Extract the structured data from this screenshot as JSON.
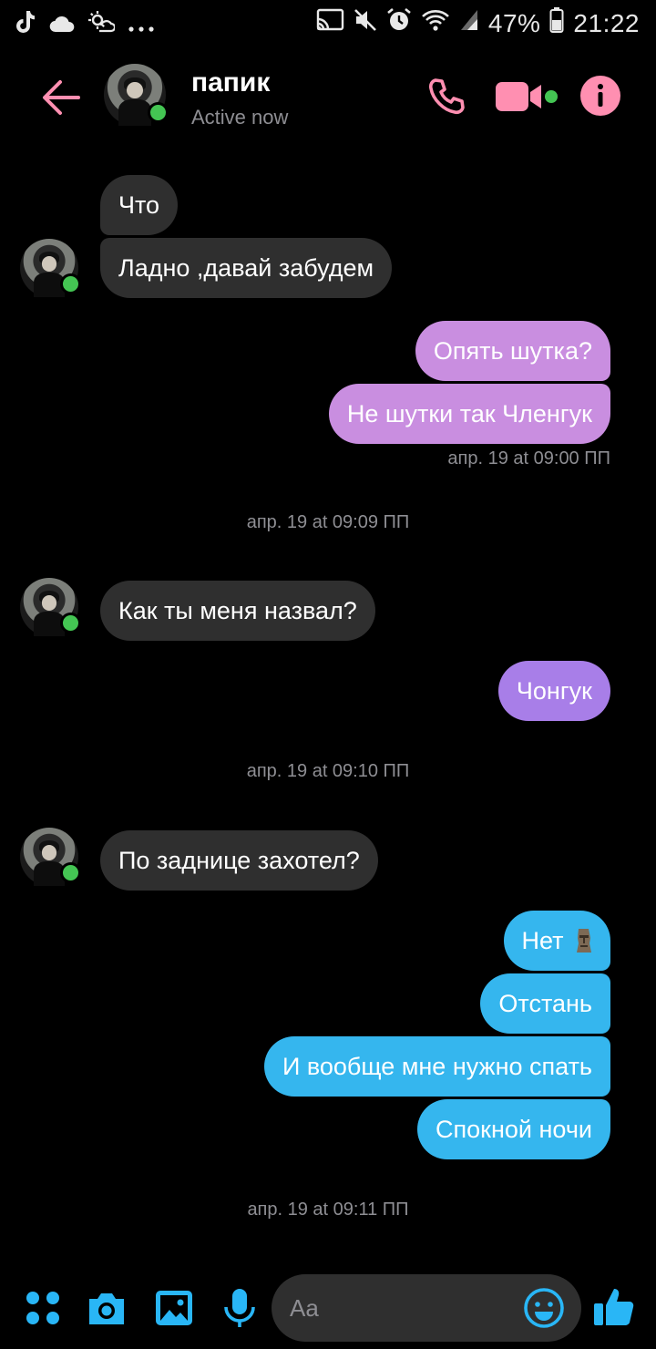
{
  "status_bar": {
    "battery": "47%",
    "time": "21:22",
    "left_icons": [
      "tiktok-icon",
      "cloud-icon",
      "weather-icon",
      "more-icon"
    ],
    "right_icons": [
      "cast-icon",
      "mute-icon",
      "alarm-icon",
      "wifi-icon",
      "signal-icon",
      "battery-icon"
    ]
  },
  "header": {
    "contact_name": "папик",
    "status": "Active now",
    "accent_color": "#ff8fb1"
  },
  "messages": {
    "m1": "Что",
    "m2": "Ладно ,давай забудем",
    "m3": "Опять шутка?",
    "m4": "Не шутки так Членгук",
    "m4_time": "апр. 19 at 09:00 ПП",
    "t1": "апр. 19 at 09:09 ПП",
    "m5": "Как ты меня назвал?",
    "m6": "Чонгук",
    "t2": "апр. 19 at 09:10 ПП",
    "m7": "По заднице захотел?",
    "m8": "Нет",
    "m9": "Отстань",
    "m10": "И вообще мне нужно спать",
    "m11": "Спокной ночи",
    "t3": "апр. 19 at 09:11 ПП"
  },
  "composer": {
    "placeholder": "Aa",
    "icons": [
      "apps-icon",
      "camera-icon",
      "gallery-icon",
      "mic-icon",
      "emoji-icon",
      "like-icon"
    ],
    "accent_color": "#29b6f6"
  }
}
